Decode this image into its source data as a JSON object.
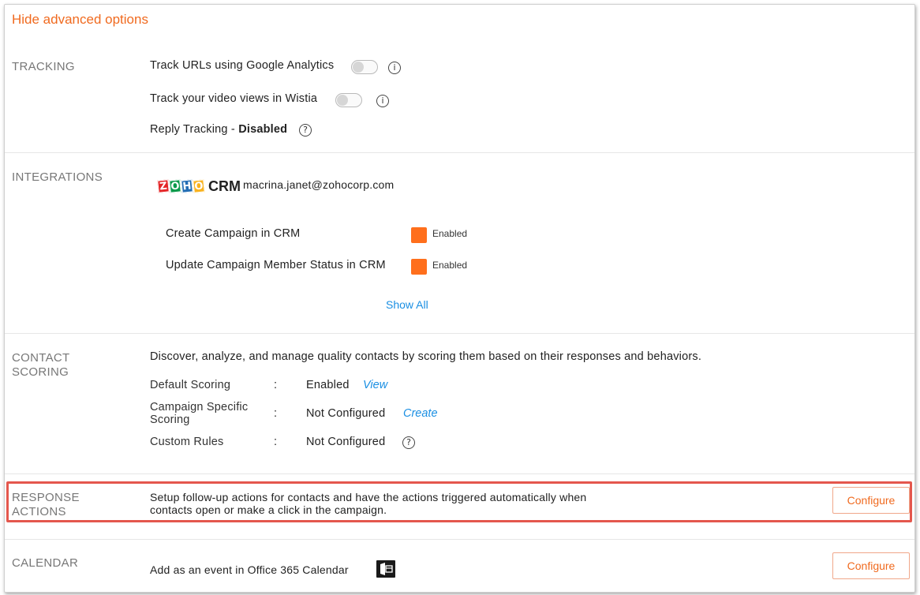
{
  "header": {
    "hide_label": "Hide advanced options"
  },
  "tracking": {
    "title": "TRACKING",
    "google_analytics_label": "Track URLs using Google Analytics",
    "wistia_label": "Track your video views in Wistia",
    "reply_prefix": "Reply Tracking - ",
    "reply_status": "Disabled"
  },
  "integrations": {
    "title": "INTEGRATIONS",
    "logo_text": "ZOHO",
    "logo_suffix": "CRM",
    "account": "macrina.janet@zohocorp.com",
    "items": [
      {
        "label": "Create Campaign in CRM",
        "status": "Enabled"
      },
      {
        "label": "Update Campaign Member Status in CRM",
        "status": "Enabled"
      }
    ],
    "show_all": "Show All"
  },
  "contact_scoring": {
    "title_line1": "CONTACT",
    "title_line2": "SCORING",
    "description": "Discover, analyze, and manage quality contacts by scoring them based on their responses and behaviors.",
    "rows": [
      {
        "label": "Default Scoring",
        "value": "Enabled",
        "link": "View"
      },
      {
        "label_line1": "Campaign Specific",
        "label_line2": "Scoring",
        "value": "Not Configured",
        "link": "Create"
      },
      {
        "label": "Custom Rules",
        "value": "Not Configured"
      }
    ],
    "colon": ":"
  },
  "response_actions": {
    "title_line1": "RESPONSE",
    "title_line2": "ACTIONS",
    "desc_line1": "Setup follow-up actions for contacts and have the actions triggered automatically when",
    "desc_line2": "contacts open or make a click in the campaign.",
    "button": "Configure"
  },
  "calendar": {
    "title": "CALENDAR",
    "label": "Add as an event in Office 365 Calendar",
    "button": "Configure"
  },
  "colors": {
    "accent": "#f06a1f",
    "link": "#1a8fe3",
    "enabled_box": "#ff6f1c",
    "highlight": "#e4574d"
  },
  "icons": [
    "info-icon",
    "help-icon",
    "zoho-crm-logo",
    "office365-calendar-icon"
  ]
}
